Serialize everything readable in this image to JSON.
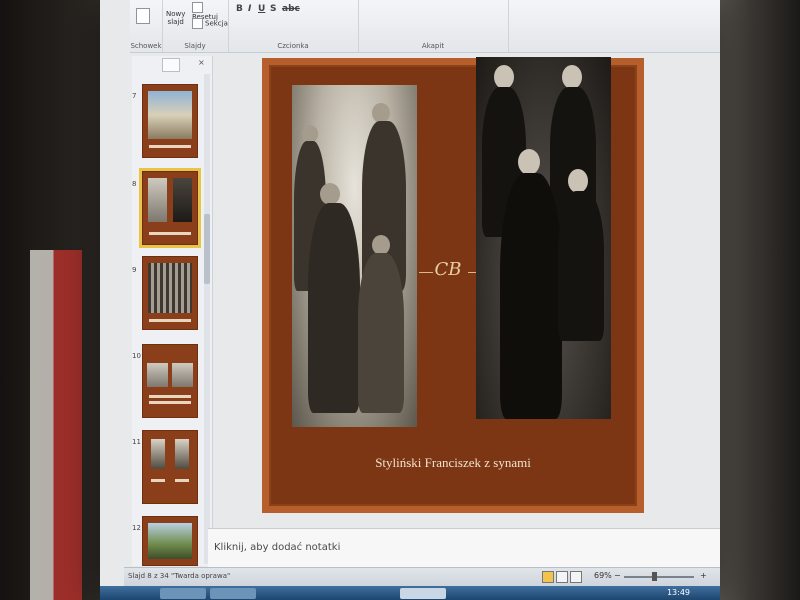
{
  "ribbon": {
    "new_slide_line1": "Nowy",
    "new_slide_line2": "slajd",
    "reset_label": "Resetuj",
    "section_label": "Sekcja",
    "group_clipboard": "Schowek",
    "group_slides": "Slajdy",
    "group_font": "Czcionka",
    "group_paragraph": "Akapit",
    "bold": "B",
    "italic": "I",
    "underline": "U",
    "strike": "S",
    "shadow": "abc"
  },
  "panel": {
    "slides": [
      {
        "number": "7"
      },
      {
        "number": "8"
      },
      {
        "number": "9"
      },
      {
        "number": "10"
      },
      {
        "number": "11"
      },
      {
        "number": "12"
      }
    ]
  },
  "slide": {
    "caption": "Styliński Franciszek z synami",
    "ornament": "CB"
  },
  "notes": {
    "placeholder": "Kliknij, aby dodać notatki"
  },
  "status": {
    "slide_counter": "Slajd 8 z 34",
    "theme": "\"Twarda oprawa\"",
    "zoom": "69%",
    "zoom_minus": "−",
    "zoom_plus": "+",
    "clock": "13:49"
  },
  "colors": {
    "slide_background": "#7d3614",
    "slide_border": "#b65f2c",
    "selected_thumb": "#e8c44a",
    "taskbar": "#1d4670"
  }
}
